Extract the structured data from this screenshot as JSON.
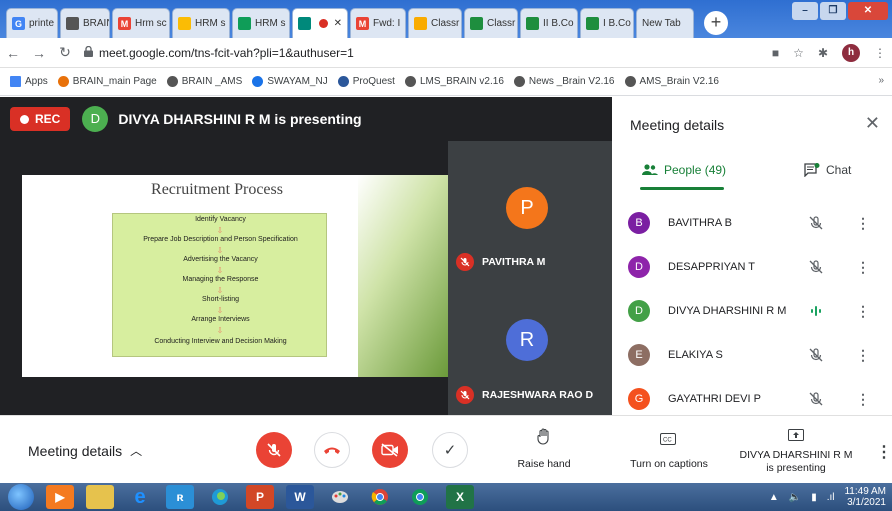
{
  "browser": {
    "tabs": [
      {
        "label": "printe",
        "favicon": "G",
        "color": "#4285f4"
      },
      {
        "label": "BRAIN",
        "favicon": "globe",
        "color": "#555555"
      },
      {
        "label": "Hrm sc",
        "favicon": "M",
        "color": "#ea4335"
      },
      {
        "label": "HRM s",
        "favicon": "drive",
        "color": "#fbbc04"
      },
      {
        "label": "HRM s",
        "favicon": "plus",
        "color": "#0f9d58"
      },
      {
        "label": "",
        "favicon": "meet",
        "color": "#00897b",
        "active": true
      },
      {
        "label": "Fwd: I",
        "favicon": "M",
        "color": "#ea4335"
      },
      {
        "label": "Classr",
        "favicon": "classroom",
        "color": "#f9ab00"
      },
      {
        "label": "Classr",
        "favicon": "classroom",
        "color": "#1e8e3e"
      },
      {
        "label": "II B.Co",
        "favicon": "classroom",
        "color": "#1e8e3e"
      },
      {
        "label": "I B.Co",
        "favicon": "classroom",
        "color": "#1e8e3e"
      },
      {
        "label": "New Tab",
        "favicon": "",
        "color": "#ffffff"
      }
    ],
    "url": "meet.google.com/tns-fcit-vah?pli=1&authuser=1",
    "profile_initial": "h",
    "bookmarks": [
      {
        "label": "Apps",
        "color": "#4285f4"
      },
      {
        "label": "BRAIN_main Page",
        "color": "#e8710a"
      },
      {
        "label": "BRAIN _AMS",
        "color": "#555555"
      },
      {
        "label": "SWAYAM_NJ",
        "color": "#1a73e8"
      },
      {
        "label": "ProQuest",
        "color": "#2b579a"
      },
      {
        "label": "LMS_BRAIN v2.16",
        "color": "#555555"
      },
      {
        "label": "News _Brain V2.16",
        "color": "#555555"
      },
      {
        "label": "AMS_Brain V2.16",
        "color": "#555555"
      }
    ],
    "bookmarks_more": "»"
  },
  "meet": {
    "rec_label": "REC",
    "presenter_initial": "D",
    "presenter_text": "DIVYA DHARSHINI R M is presenting",
    "slide": {
      "title": "Recruitment Process",
      "steps": [
        "Identify Vacancy",
        "Prepare Job Description and Person Specification",
        "Advertising the Vacancy",
        "Managing the Response",
        "Short-listing",
        "Arrange Interviews",
        "Conducting Interview and Decision Making"
      ]
    },
    "tiles": [
      {
        "initial": "P",
        "name": "PAVITHRA M",
        "color": "#f4761b"
      },
      {
        "initial": "R",
        "name": "RAJESHWARA RAO D",
        "color": "#4e6ed8"
      }
    ]
  },
  "panel": {
    "title": "Meeting details",
    "people_tab": "People (49)",
    "chat_tab": "Chat",
    "people": [
      {
        "initial": "B",
        "name": "BAVITHRA B",
        "color": "#7b1fa2",
        "mic": "muted"
      },
      {
        "initial": "D",
        "name": "DESAPPRIYAN T",
        "color": "#8e24aa",
        "mic": "muted"
      },
      {
        "initial": "D",
        "name": "DIVYA DHARSHINI R M",
        "color": "#43a047",
        "mic": "speaking"
      },
      {
        "initial": "E",
        "name": "ELAKIYA S",
        "color": "#8d6e63",
        "mic": "muted"
      },
      {
        "initial": "G",
        "name": "GAYATHRI DEVI P",
        "color": "#f4511e",
        "mic": "muted"
      }
    ]
  },
  "controls": {
    "meeting_details": "Meeting details",
    "raise_hand": "Raise hand",
    "captions": "Turn on captions",
    "presenting_line1": "DIVYA DHARSHINI R M",
    "presenting_line2": "is presenting"
  },
  "taskbar": {
    "time": "11:49 AM",
    "date": "3/1/2021"
  }
}
